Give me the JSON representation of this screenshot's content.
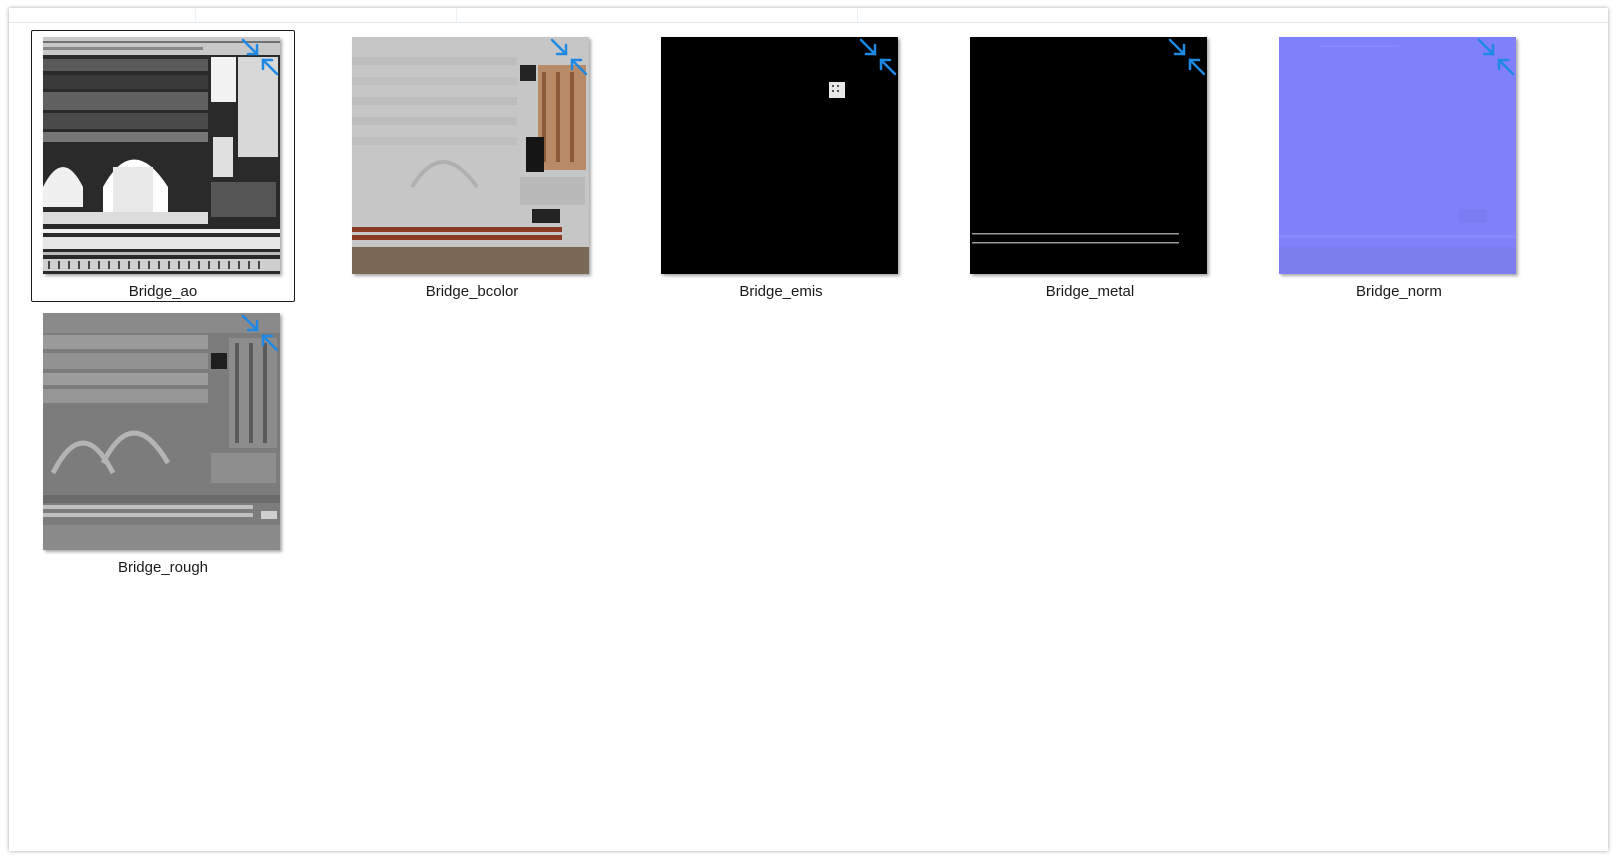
{
  "window": {
    "accent_color": "#1e88e5"
  },
  "files": [
    {
      "name": "Bridge_ao",
      "selected": true,
      "badge_icon": "compress-arrows-icon"
    },
    {
      "name": "Bridge_bcolor",
      "selected": false,
      "badge_icon": "compress-arrows-icon"
    },
    {
      "name": "Bridge_emis",
      "selected": false,
      "badge_icon": "compress-arrows-icon"
    },
    {
      "name": "Bridge_metal",
      "selected": false,
      "badge_icon": "compress-arrows-icon"
    },
    {
      "name": "Bridge_norm",
      "selected": false,
      "badge_icon": "compress-arrows-icon"
    },
    {
      "name": "Bridge_rough",
      "selected": false,
      "badge_icon": "compress-arrows-icon"
    }
  ]
}
